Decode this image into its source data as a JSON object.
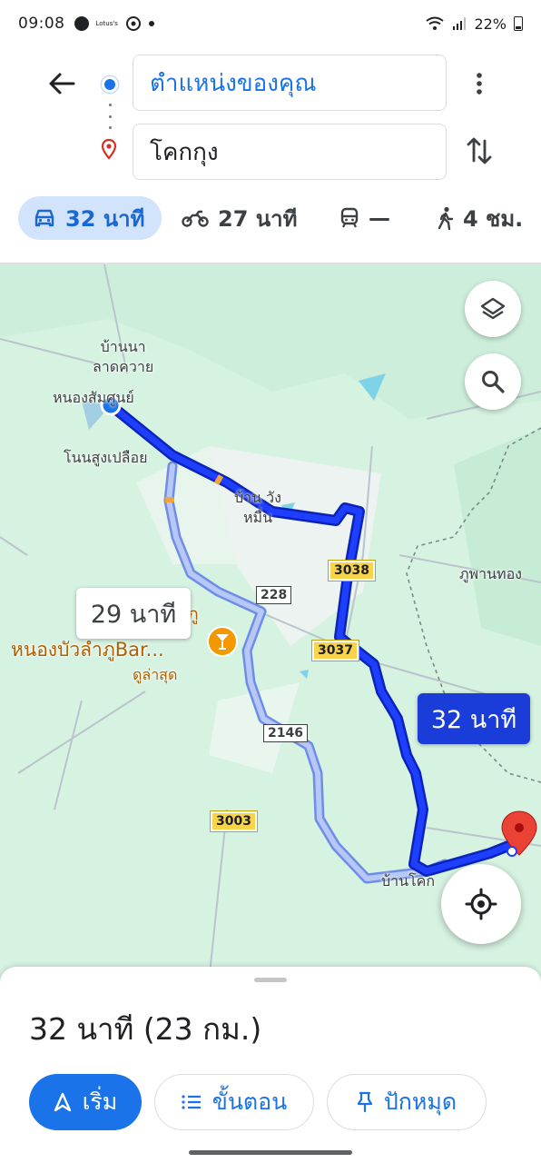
{
  "status_bar": {
    "time": "09:08",
    "battery": "22%",
    "app_tag": "Lotus's"
  },
  "directions": {
    "origin": "ตำแหน่งของคุณ",
    "destination": "โคกกุง"
  },
  "modes": [
    {
      "name": "drive",
      "label": "32 นาที",
      "active": true
    },
    {
      "name": "motorcycle",
      "label": "27 นาที",
      "active": false
    },
    {
      "name": "transit",
      "label": "—",
      "active": false
    },
    {
      "name": "walk",
      "label": "4 ชม.",
      "active": false
    }
  ],
  "map": {
    "place_labels": {
      "ban_na": "บ้านนา\nลาดควาย",
      "nong_samsun": "หนองสัมศูนย์",
      "non_sung": "โนนสูงเปลือย",
      "ban_wang": "บ้าน วัง\nหมื่น",
      "phu_phan": "ภูพานทอง",
      "ban_khok": "บ้านโคก"
    },
    "roads": {
      "r3038": "3038",
      "r3037": "3037",
      "r228": "228",
      "r2146": "2146",
      "r3003": "3003"
    },
    "poi": {
      "name": "หนองบัวลำภูBar...",
      "sub": "ดูล่าสุด",
      "partial": "ภู"
    },
    "alt_route_time": "29 นาที",
    "main_route_time": "32 นาที"
  },
  "sheet": {
    "summary": "32 นาที (23 กม.)",
    "start_label": "เริ่ม",
    "steps_label": "ขั้นตอน",
    "pin_label": "ปักหมุด"
  },
  "colors": {
    "primary": "#1a73e8",
    "route_main": "#1a3dd9",
    "route_alt": "#9aaef2",
    "map_bg": "#d6f2e1"
  }
}
